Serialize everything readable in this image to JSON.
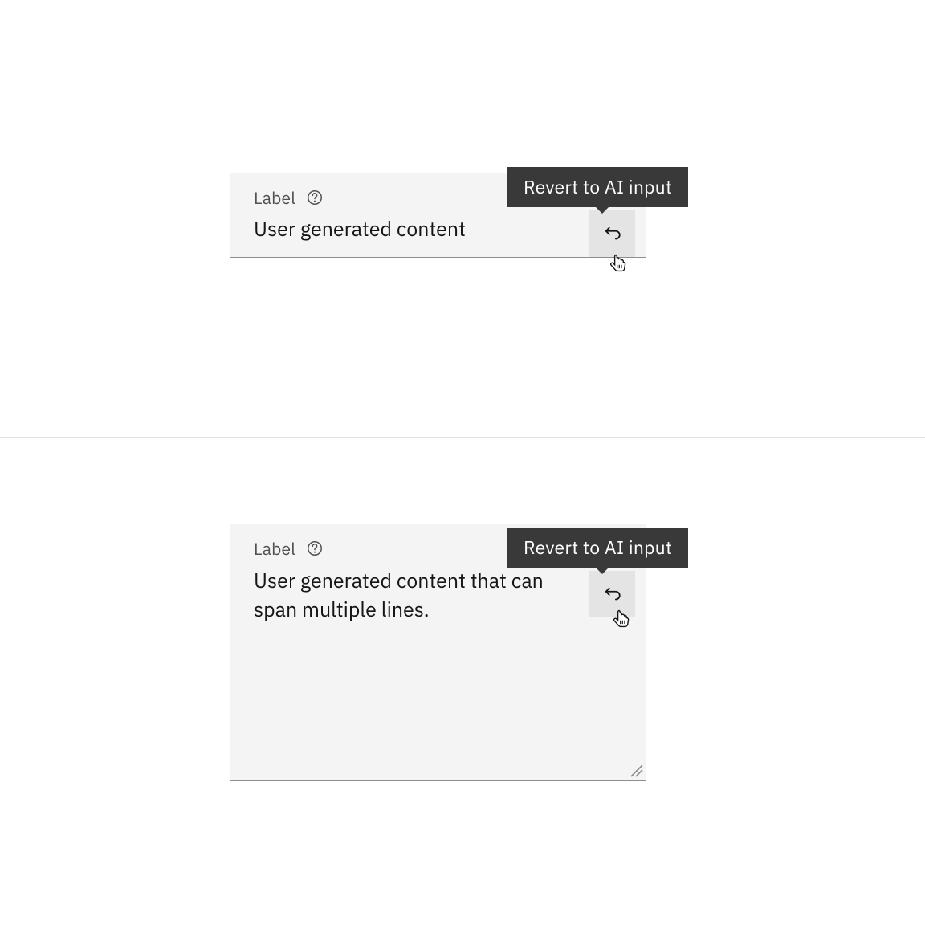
{
  "tooltip_text": "Revert to AI input",
  "field1": {
    "label": "Label",
    "value": "User generated content"
  },
  "field2": {
    "label": "Label",
    "value": "User generated content that can span multiple lines."
  }
}
